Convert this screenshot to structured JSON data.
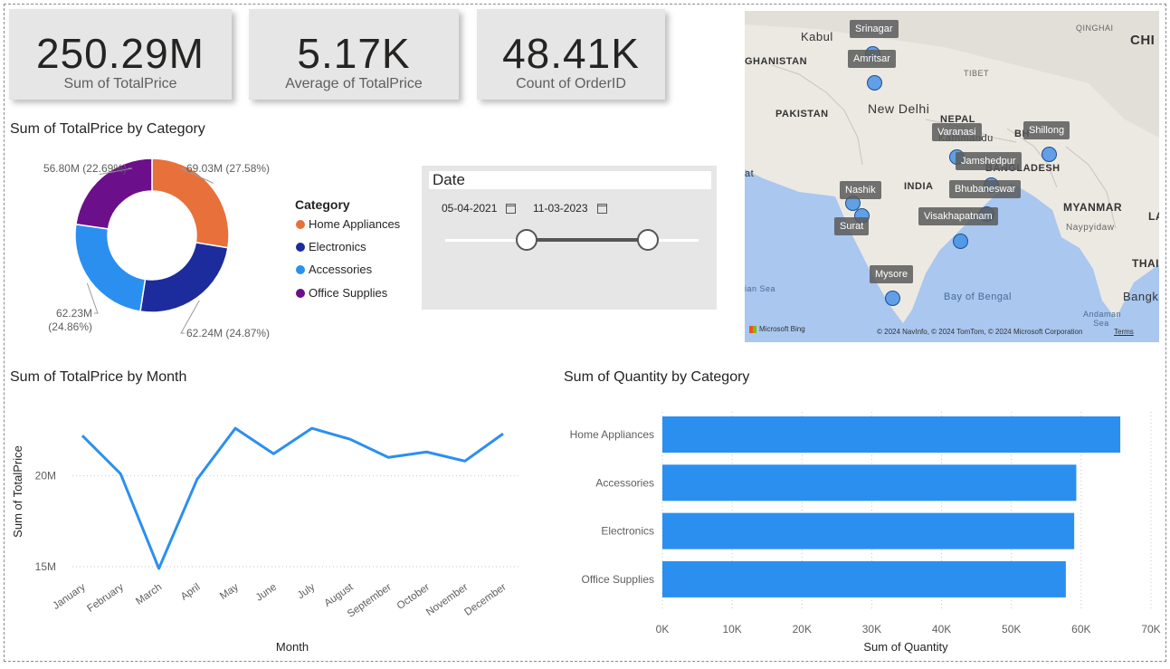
{
  "kpis": [
    {
      "value": "250.29M",
      "label": "Sum of TotalPrice"
    },
    {
      "value": "5.17K",
      "label": "Average of TotalPrice"
    },
    {
      "value": "48.41K",
      "label": "Count of OrderID"
    }
  ],
  "donut": {
    "title": "Sum of TotalPrice by Category",
    "legend_title": "Category",
    "legend": [
      {
        "label": "Home Appliances",
        "color": "#e8703a"
      },
      {
        "label": "Electronics",
        "color": "#1c2c9c"
      },
      {
        "label": "Accessories",
        "color": "#2b8ff0"
      },
      {
        "label": "Office Supplies",
        "color": "#6b0f8a"
      }
    ]
  },
  "slicer": {
    "title": "Date",
    "start_date": "05-04-2021",
    "end_date": "11-03-2023",
    "start_fraction": 0.32,
    "end_fraction": 0.8
  },
  "map": {
    "labels": [
      "Kabul",
      "GHANISTAN",
      "PAKISTAN",
      "New Delhi",
      "NEPAL",
      "Kathmandu",
      "INDIA",
      "BANGLADESH",
      "MYANMAR",
      "Naypyidaw",
      "QINGHAI",
      "TIBET",
      "CHI",
      "LA",
      "THAIL",
      "Bangko",
      "Bay of Bengal",
      "ian Sea",
      "Andaman Sea",
      "BH",
      "at"
    ],
    "cities": [
      "Srinagar",
      "Amritsar",
      "Varanasi",
      "Shillong",
      "Jamshedpur",
      "Bhubaneswar",
      "Nashik",
      "Surat",
      "Visakhapatnam",
      "Mysore"
    ],
    "bing_label": "Microsoft Bing",
    "copyright": "© 2024 NavInfo, © 2024 TomTom, © 2024 Microsoft Corporation",
    "terms": "Terms"
  },
  "chart_data": [
    {
      "type": "pie",
      "title": "Sum of TotalPrice by Category",
      "categories": [
        "Home Appliances",
        "Electronics",
        "Accessories",
        "Office Supplies"
      ],
      "values": [
        69.03,
        62.24,
        62.23,
        56.8
      ],
      "data_labels": [
        "69.03M (27.58%)",
        "62.24M (24.87%)",
        "62.23M (24.86%)",
        "56.80M (22.69%)"
      ],
      "colors": [
        "#e8703a",
        "#1c2c9c",
        "#2b8ff0",
        "#6b0f8a"
      ],
      "legend": "right"
    },
    {
      "type": "line",
      "title": "Sum of TotalPrice by Month",
      "xlabel": "Month",
      "ylabel": "Sum of TotalPrice",
      "categories": [
        "January",
        "February",
        "March",
        "April",
        "May",
        "June",
        "July",
        "August",
        "September",
        "October",
        "November",
        "December"
      ],
      "values": [
        22.2,
        20.1,
        14.9,
        19.8,
        22.6,
        21.2,
        22.6,
        22.0,
        21.0,
        21.3,
        20.8,
        22.3
      ],
      "yticks": [
        {
          "value": 15,
          "label": "15M"
        },
        {
          "value": 20,
          "label": "20M"
        }
      ],
      "ylim": [
        14.8,
        23.5
      ],
      "color": "#2b8ff0",
      "grid": true
    },
    {
      "type": "bar",
      "orientation": "horizontal",
      "title": "Sum of Quantity by Category",
      "xlabel": "Sum of Quantity",
      "categories": [
        "Home Appliances",
        "Accessories",
        "Electronics",
        "Office Supplies"
      ],
      "values": [
        65600,
        59300,
        59000,
        57800
      ],
      "xticks": [
        "0K",
        "10K",
        "20K",
        "30K",
        "40K",
        "50K",
        "60K",
        "70K"
      ],
      "xlim": [
        0,
        70000
      ],
      "color": "#2b8ff0"
    }
  ]
}
